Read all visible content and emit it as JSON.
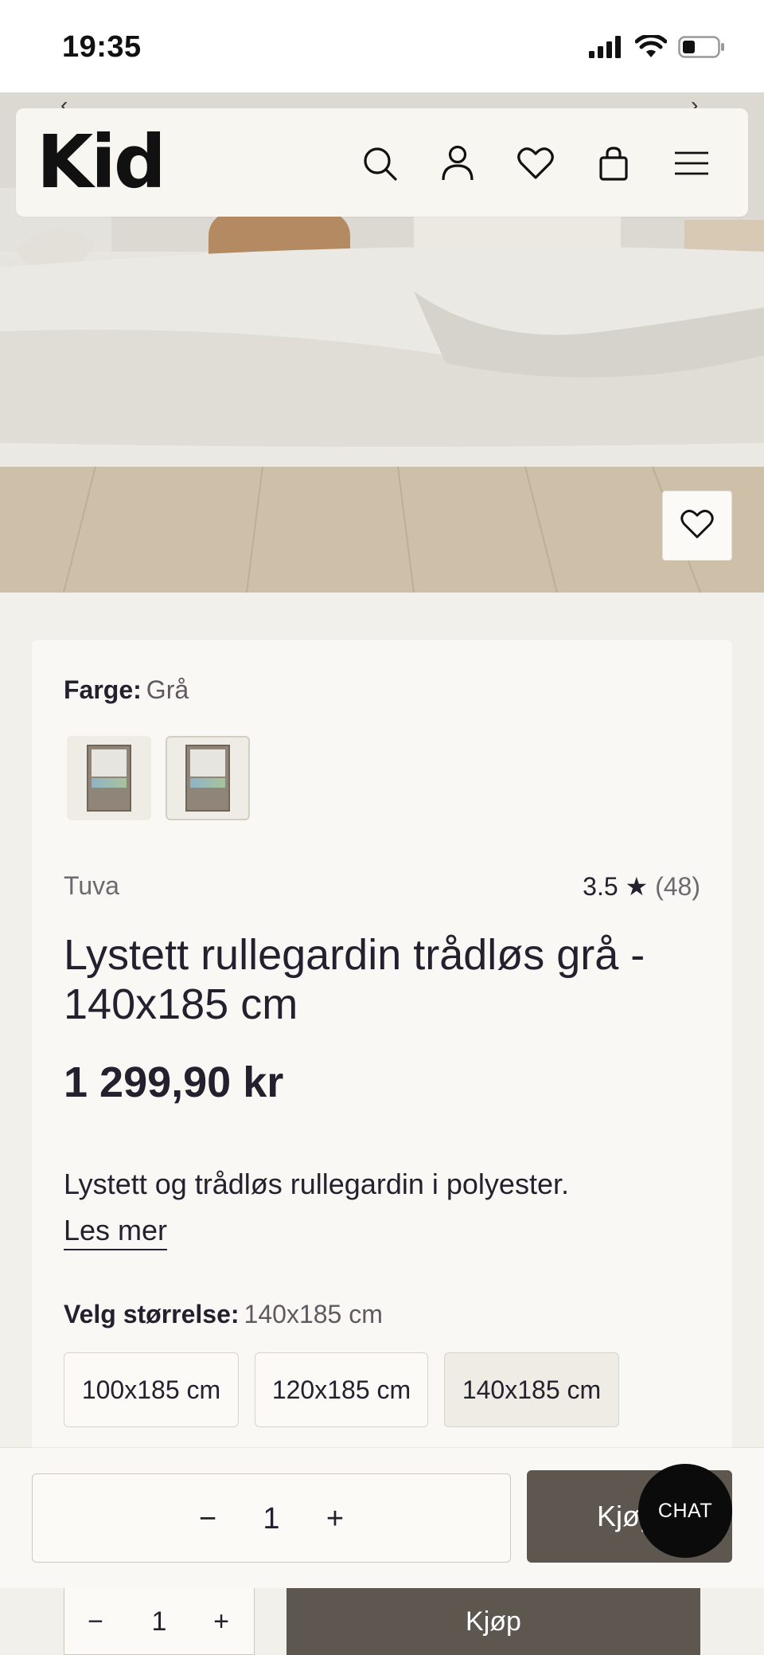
{
  "status_bar": {
    "time": "19:35"
  },
  "header": {
    "logo": "Kid"
  },
  "hero": {
    "prev_arrow": "‹",
    "next_arrow": "›"
  },
  "product": {
    "color_label": "Farge:",
    "color_value": "Grå",
    "brand": "Tuva",
    "rating_value": "3.5",
    "rating_star": "★",
    "rating_count": "(48)",
    "title": "Lystett rullegardin trådløs grå - 140x185 cm",
    "price": "1 299,90 kr",
    "description": "Lystett og trådløs rullegardin i polyester.",
    "read_more": "Les mer",
    "size_label": "Velg størrelse:",
    "size_value": "140x185 cm",
    "sizes": [
      "100x185 cm",
      "120x185 cm",
      "140x185 cm"
    ]
  },
  "buy_bar": {
    "minus": "−",
    "quantity": "1",
    "plus": "+",
    "buy_label": "Kjøp"
  },
  "chat": {
    "label": "CHAT"
  },
  "lower_bar": {
    "minus": "−",
    "quantity": "1",
    "plus": "+",
    "buy_label": "Kjøp"
  },
  "colors": {
    "accent_button": "#5d5750",
    "chat_bg": "#0b0b0b",
    "page_bg": "#f2f0ea",
    "card_bg": "#faf8f4"
  }
}
